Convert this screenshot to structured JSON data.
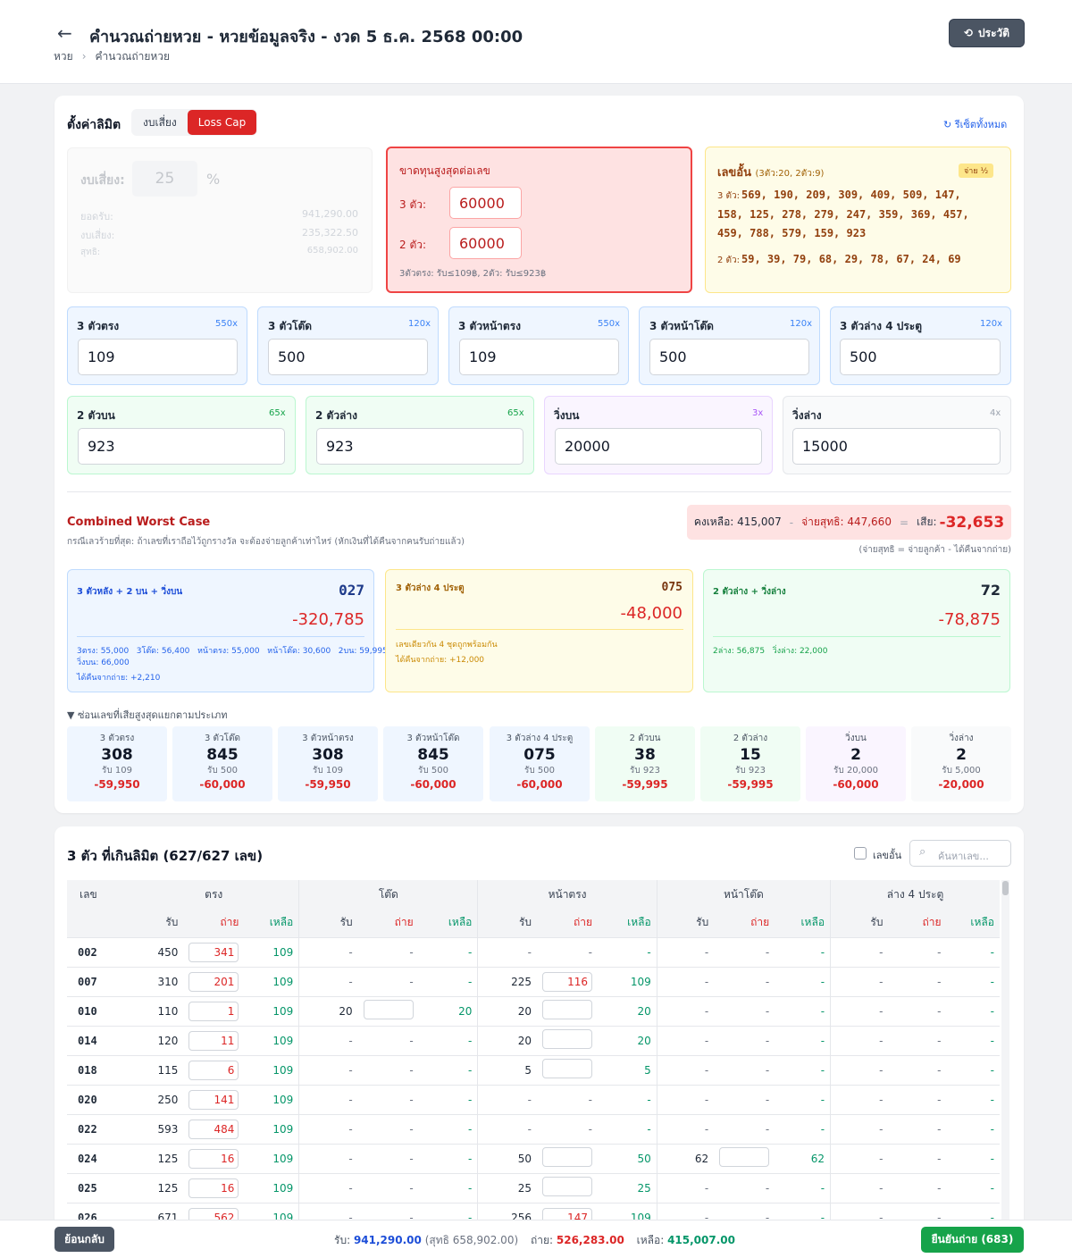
{
  "header": {
    "title": "คำนวณถ่ายหวย - หวยข้อมูลจริง - งวด 5 ธ.ค. 2568 00:00",
    "breadcrumb": [
      "หวย",
      "คำนวณถ่ายหวย"
    ],
    "history_label": "ประวัติ"
  },
  "settings": {
    "title": "ตั้งค่าลิมิต",
    "mode_tabs": [
      "งบเสี่ยง",
      "Loss Cap"
    ],
    "active_mode": "Loss Cap",
    "reset_label": "รีเซ็ตทั้งหมด",
    "risk_budget": {
      "label": "งบเสี่ยง:",
      "value": "25",
      "unit": "%",
      "rows": [
        {
          "label": "ยอดรับ:",
          "value": "941,290.00"
        },
        {
          "label": "งบเสี่ยง:",
          "value": "235,322.50"
        },
        {
          "label": "สุทธิ:",
          "value": "658,902.00"
        }
      ]
    },
    "max_loss": {
      "title": "ขาดทุนสูงสุดต่อเลข",
      "three_label": "3 ตัว:",
      "three_value": "60000",
      "two_label": "2 ตัว:",
      "two_value": "60000",
      "note": "3ตัวตรง: รับ≤109฿, 2ตัว: รับ≤923฿"
    },
    "half_pay": {
      "title": "เลขอั้น",
      "subtitle": "(3ตัว:20, 2ตัว:9)",
      "badge": "จ่าย ½",
      "three_label": "3 ตัว:",
      "three_line1": "569, 190, 209, 309, 409, 509, 147,",
      "three_line2": "158, 125, 278, 279, 247, 359, 369, 457,",
      "three_line3": "459, 788, 579, 159, 923",
      "two_label": "2 ตัว:",
      "two_line": "59, 39, 79, 68, 29, 78, 67, 24, 69"
    },
    "limits_row1": [
      {
        "label": "3 ตัวตรง",
        "rate": "550x",
        "value": "109"
      },
      {
        "label": "3 ตัวโต๊ด",
        "rate": "120x",
        "value": "500"
      },
      {
        "label": "3 ตัวหน้าตรง",
        "rate": "550x",
        "value": "109"
      },
      {
        "label": "3 ตัวหน้าโต๊ด",
        "rate": "120x",
        "value": "500"
      },
      {
        "label": "3 ตัวล่าง 4 ประตู",
        "rate": "120x",
        "value": "500"
      }
    ],
    "limits_row2": [
      {
        "label": "2 ตัวบน",
        "rate": "65x",
        "value": "923"
      },
      {
        "label": "2 ตัวล่าง",
        "rate": "65x",
        "value": "923"
      },
      {
        "label": "วิ่งบน",
        "rate": "3x",
        "value": "20000"
      },
      {
        "label": "วิ่งล่าง",
        "rate": "4x",
        "value": "15000"
      }
    ]
  },
  "worst": {
    "title": "Combined Worst Case",
    "desc": "กรณีเลวร้ายที่สุด: ถ้าเลขที่เราถือไว้ถูกรางวัล จะต้องจ่ายลูกค้าเท่าไหร่ (หักเงินที่ได้คืนจากคนรับถ่ายแล้ว)",
    "summary_keep": "คงเหลือ: 415,007",
    "summary_minus": "-",
    "summary_pay": "จ่ายสุทธิ: 447,660",
    "summary_eq": "=",
    "summary_loss_label": "เสีย:",
    "summary_loss_value": "-32,653",
    "summary_note": "(จ่ายสุทธิ = จ่ายลูกค้า - ได้คืนจากถ่าย)",
    "cards": [
      {
        "title": "3 ตัวหลัง + 2 บน + วิ่งบน",
        "number": "027",
        "loss": "-320,785",
        "detail1": "3ตรง: 55,000   3โต๊ด: 56,400   หน้าตรง: 55,000   หน้าโต๊ด: 30,600   2บน: 59,995",
        "detail2": "วิ่งบน: 66,000",
        "detail3": "ได้คืนจากถ่าย: +2,210"
      },
      {
        "title": "3 ตัวล่าง 4 ประตู",
        "number": "075",
        "loss": "-48,000",
        "detail1": "เลขเดียวกัน 4 ชุดถูกพร้อมกัน",
        "detail2": "ได้คืนจากถ่าย: +12,000"
      },
      {
        "title": "2 ตัวล่าง + วิ่งล่าง",
        "number": "72",
        "loss": "-78,875",
        "detail1": "2ล่าง: 56,875   วิ่งล่าง: 22,000"
      }
    ],
    "collapse_label": "▼ ซ่อนเลขที่เสียสูงสุดแยกตามประเภท",
    "tiles": [
      {
        "label": "3 ตัวตรง",
        "num": "308",
        "recv": "รับ 109",
        "loss": "-59,950"
      },
      {
        "label": "3 ตัวโต๊ด",
        "num": "845",
        "recv": "รับ 500",
        "loss": "-60,000"
      },
      {
        "label": "3 ตัวหน้าตรง",
        "num": "308",
        "recv": "รับ 109",
        "loss": "-59,950"
      },
      {
        "label": "3 ตัวหน้าโต๊ด",
        "num": "845",
        "recv": "รับ 500",
        "loss": "-60,000"
      },
      {
        "label": "3 ตัวล่าง 4 ประตู",
        "num": "075",
        "recv": "รับ 500",
        "loss": "-60,000"
      },
      {
        "label": "2 ตัวบน",
        "num": "38",
        "recv": "รับ 923",
        "loss": "-59,995"
      },
      {
        "label": "2 ตัวล่าง",
        "num": "15",
        "recv": "รับ 923",
        "loss": "-59,995"
      },
      {
        "label": "วิ่งบน",
        "num": "2",
        "recv": "รับ 20,000",
        "loss": "-60,000"
      },
      {
        "label": "วิ่งล่าง",
        "num": "2",
        "recv": "รับ 5,000",
        "loss": "-20,000"
      }
    ],
    "colors": {
      "blue": "#eff6ff",
      "yellow": "#fefce8",
      "green": "#f0fdf4",
      "purple": "#faf5ff",
      "red": "#dc2626"
    }
  },
  "table": {
    "title": "3 ตัว ที่เกินลิมิต (627/627 เลข)",
    "half_checkbox_label": "เลขอั้น",
    "search_placeholder": "ค้นหาเลข...",
    "col_num": "เลข",
    "groups": [
      "ตรง",
      "โต๊ด",
      "หน้าตรง",
      "หน้าโต๊ด",
      "ล่าง 4 ประตู"
    ],
    "sub": [
      "รับ",
      "ถ่าย",
      "เหลือ"
    ],
    "rows": [
      {
        "n": "002",
        "c": [
          [
            "450",
            "341",
            "109"
          ],
          [
            "-",
            "-",
            "-"
          ],
          [
            "-",
            "-",
            "-"
          ],
          [
            "-",
            "-",
            "-"
          ],
          [
            "-",
            "-",
            "-"
          ]
        ]
      },
      {
        "n": "007",
        "c": [
          [
            "310",
            "201",
            "109"
          ],
          [
            "-",
            "-",
            "-"
          ],
          [
            "225",
            "116",
            "109"
          ],
          [
            "-",
            "-",
            "-"
          ],
          [
            "-",
            "-",
            "-"
          ]
        ]
      },
      {
        "n": "010",
        "c": [
          [
            "110",
            "1",
            "109"
          ],
          [
            "20",
            "",
            "20"
          ],
          [
            "20",
            "",
            "20"
          ],
          [
            "-",
            "-",
            "-"
          ],
          [
            "-",
            "-",
            "-"
          ]
        ]
      },
      {
        "n": "014",
        "c": [
          [
            "120",
            "11",
            "109"
          ],
          [
            "-",
            "-",
            "-"
          ],
          [
            "20",
            "",
            "20"
          ],
          [
            "-",
            "-",
            "-"
          ],
          [
            "-",
            "-",
            "-"
          ]
        ]
      },
      {
        "n": "018",
        "c": [
          [
            "115",
            "6",
            "109"
          ],
          [
            "-",
            "-",
            "-"
          ],
          [
            "5",
            "",
            "5"
          ],
          [
            "-",
            "-",
            "-"
          ],
          [
            "-",
            "-",
            "-"
          ]
        ]
      },
      {
        "n": "020",
        "c": [
          [
            "250",
            "141",
            "109"
          ],
          [
            "-",
            "-",
            "-"
          ],
          [
            "-",
            "-",
            "-"
          ],
          [
            "-",
            "-",
            "-"
          ],
          [
            "-",
            "-",
            "-"
          ]
        ]
      },
      {
        "n": "022",
        "c": [
          [
            "593",
            "484",
            "109"
          ],
          [
            "-",
            "-",
            "-"
          ],
          [
            "-",
            "-",
            "-"
          ],
          [
            "-",
            "-",
            "-"
          ],
          [
            "-",
            "-",
            "-"
          ]
        ]
      },
      {
        "n": "024",
        "c": [
          [
            "125",
            "16",
            "109"
          ],
          [
            "-",
            "-",
            "-"
          ],
          [
            "50",
            "",
            "50"
          ],
          [
            "62",
            "",
            "62"
          ],
          [
            "-",
            "-",
            "-"
          ]
        ]
      },
      {
        "n": "025",
        "c": [
          [
            "125",
            "16",
            "109"
          ],
          [
            "-",
            "-",
            "-"
          ],
          [
            "25",
            "",
            "25"
          ],
          [
            "-",
            "-",
            "-"
          ],
          [
            "-",
            "-",
            "-"
          ]
        ]
      },
      {
        "n": "026",
        "c": [
          [
            "671",
            "562",
            "109"
          ],
          [
            "-",
            "-",
            "-"
          ],
          [
            "256",
            "147",
            "109"
          ],
          [
            "-",
            "-",
            "-"
          ],
          [
            "-",
            "-",
            "-"
          ]
        ]
      }
    ]
  },
  "footer": {
    "back_label": "ย้อนกลับ",
    "recv_label": "รับ:",
    "recv_value": "941,290.00",
    "net_note": "(สุทธิ 658,902.00)",
    "out_label": "ถ่าย:",
    "out_value": "526,283.00",
    "remain_label": "เหลือ:",
    "remain_value": "415,007.00",
    "confirm_label": "ยืนยันถ่าย (683)"
  }
}
